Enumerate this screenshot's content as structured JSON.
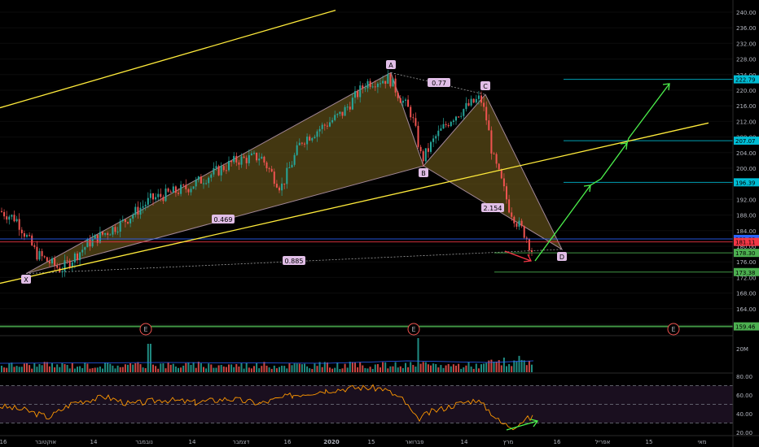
{
  "chart_data": {
    "type": "candlestick",
    "price_axis": {
      "ticks": [
        "240.00",
        "236.00",
        "232.00",
        "228.00",
        "224.00",
        "220.00",
        "216.00",
        "212.00",
        "208.00",
        "204.00",
        "200.00",
        "196.00",
        "192.00",
        "188.00",
        "184.00",
        "180.00",
        "176.00",
        "172.00",
        "168.00",
        "164.00",
        "160.00"
      ],
      "range": [
        156,
        242
      ]
    },
    "time_axis": {
      "labels": [
        "16",
        "אוקטובר",
        "14",
        "נובמבר",
        "14",
        "דצמבר",
        "16",
        "2020",
        "15",
        "פברואר",
        "14",
        "מרץ",
        "16",
        "אפריל",
        "15",
        "מאי"
      ]
    },
    "price_tags": [
      {
        "value": 222.79,
        "label": "222.79",
        "color": "#00bcd4"
      },
      {
        "value": 207.07,
        "label": "207.07",
        "color": "#00bcd4"
      },
      {
        "value": 196.39,
        "label": "196.39",
        "color": "#00bcd4"
      },
      {
        "value": 181.88,
        "label": "181.88",
        "color": "#2962ff"
      },
      {
        "value": 181.11,
        "label": "181.11",
        "color": "#f23645"
      },
      {
        "value": 178.3,
        "label": "178.30",
        "color": "#4caf50"
      },
      {
        "value": 173.38,
        "label": "173.38",
        "color": "#4caf50"
      },
      {
        "value": 159.46,
        "label": "159.46",
        "color": "#4caf50"
      }
    ],
    "harmonic_pattern": {
      "points": [
        {
          "label": "X",
          "price": 173.0
        },
        {
          "label": "A",
          "price": 224.5
        },
        {
          "label": "B",
          "price": 200.6
        },
        {
          "label": "C",
          "price": 218.9
        },
        {
          "label": "D",
          "price": 179.2
        }
      ],
      "ratios": [
        "0.77",
        "0.469",
        "2.154",
        "0.885"
      ]
    },
    "event_markers": [
      "E",
      "E",
      "E"
    ],
    "volume_axis": {
      "ticks": [
        "20M"
      ]
    },
    "rsi_axis": {
      "ticks": [
        "80.00",
        "60.00",
        "40.00",
        "20.00"
      ]
    },
    "colors": {
      "up": "#26a69a",
      "down": "#ef5350",
      "pattern_fill": "#5a4a17",
      "pattern_line": "#d8b4c8",
      "trendline": "#ffeb3b",
      "projection": "#4cf04c",
      "rsi": "#ff9800"
    }
  }
}
